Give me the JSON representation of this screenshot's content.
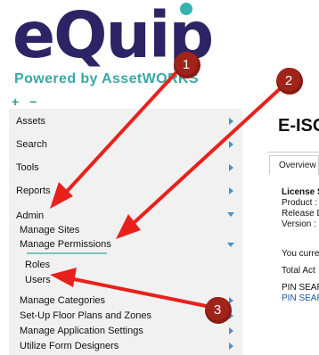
{
  "logo": {
    "wordmark": "eQuip",
    "tagline": "Powered by AssetWORKS",
    "brand_color": "#2d2466",
    "accent_color": "#36b3b0"
  },
  "expand_collapse": {
    "label": "+ −"
  },
  "sidebar": {
    "items": [
      {
        "label": "Assets"
      },
      {
        "label": "Search"
      },
      {
        "label": "Tools"
      },
      {
        "label": "Reports"
      },
      {
        "label": "Admin"
      },
      {
        "label": "Manage Sites"
      },
      {
        "label": "Manage Permissions"
      },
      {
        "label": "Roles"
      },
      {
        "label": "Users"
      },
      {
        "label": "Manage Categories"
      },
      {
        "label": "Set-Up Floor Plans and Zones"
      },
      {
        "label": "Manage Application Settings"
      },
      {
        "label": "Utilize Form Designers"
      }
    ]
  },
  "main": {
    "title": "E-ISC",
    "tab_overview": "Overview",
    "lines": [
      "License S",
      "Product :",
      "Release D",
      "Version :",
      "You curre",
      "Total Act",
      "PIN SEAR",
      "PIN SEAR"
    ]
  },
  "annotations": {
    "color": "#e8211c",
    "badges": [
      "1",
      "2",
      "3"
    ]
  }
}
